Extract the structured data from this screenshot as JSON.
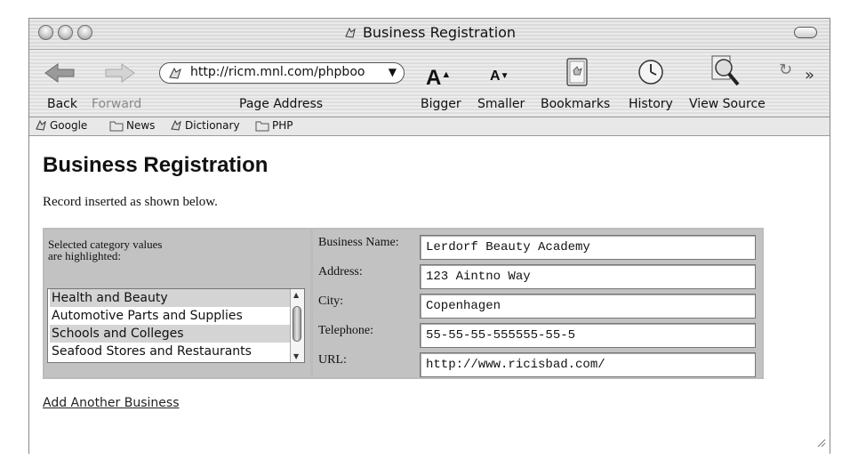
{
  "window": {
    "title": "Business Registration"
  },
  "toolbar": {
    "back_label": "Back",
    "forward_label": "Forward",
    "address_label": "Page Address",
    "address_value": "http://ricm.mnl.com/phpboo",
    "bigger_label": "Bigger",
    "smaller_label": "Smaller",
    "bookmarks_label": "Bookmarks",
    "history_label": "History",
    "view_source_label": "View Source",
    "bigger_glyph": "A",
    "smaller_glyph": "A",
    "overflow_glyph": "»"
  },
  "bookmarks_bar": {
    "items": [
      {
        "label": "Google",
        "icon": "site-icon"
      },
      {
        "label": "News",
        "icon": "folder-icon"
      },
      {
        "label": "Dictionary",
        "icon": "site-icon"
      },
      {
        "label": "PHP",
        "icon": "folder-icon"
      }
    ]
  },
  "page": {
    "heading": "Business Registration",
    "message": "Record inserted as shown below.",
    "categories_caption_line1": "Selected category values",
    "categories_caption_line2": "are highlighted:",
    "categories": [
      {
        "label": "Health and Beauty",
        "selected": true
      },
      {
        "label": "Automotive Parts and Supplies",
        "selected": false
      },
      {
        "label": "Schools and Colleges",
        "selected": true
      },
      {
        "label": "Seafood Stores and Restaurants",
        "selected": false
      }
    ],
    "fields": [
      {
        "label": "Business Name:",
        "value": "Lerdorf Beauty Academy"
      },
      {
        "label": "Address:",
        "value": "123 Aintno Way"
      },
      {
        "label": "City:",
        "value": "Copenhagen"
      },
      {
        "label": "Telephone:",
        "value": "55-55-55-555555-55-5"
      },
      {
        "label": "URL:",
        "value": "http://www.ricisbad.com/"
      }
    ],
    "add_link": "Add Another Business"
  }
}
